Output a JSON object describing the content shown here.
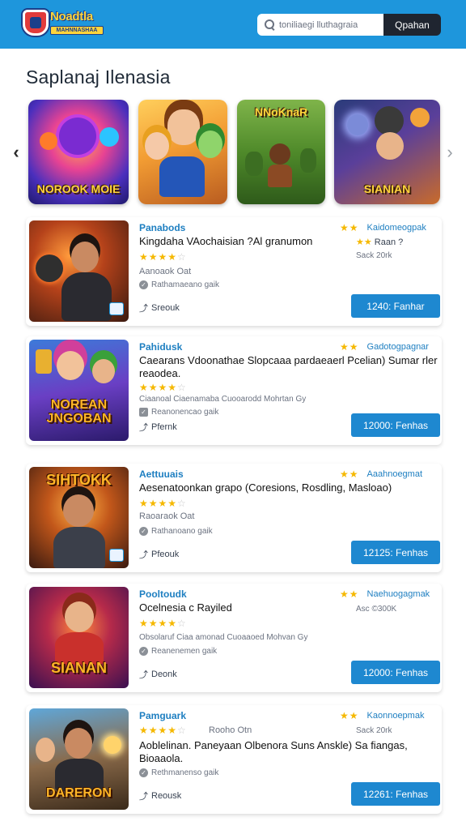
{
  "header": {
    "logo_word": "Noadtla",
    "logo_sub": "MAHNNASHAA",
    "search_placeholder": "toniliaegi lluthagraia",
    "search_button": "Qpahan"
  },
  "page_title": "Saplanaj Ilenasia",
  "carousel": {
    "tiles": [
      {
        "caption": "NOROOK MOIE"
      },
      {
        "caption": ""
      },
      {
        "caption": "NNoKnaR"
      },
      {
        "caption": "SIANIAN"
      }
    ]
  },
  "cards": [
    {
      "category": "Panabods",
      "title": "Kingdaha VAochaisian ?Al granumon",
      "rating_label": "Kaidomeogpak",
      "side_meta_1": "Raan ?",
      "side_meta_2": "Sack 20rk",
      "meta_1": "Aanoaok Oat",
      "check_text": "Rathamaeano gaik",
      "share_text": "Sreouk",
      "price": "1240: Fanhar",
      "thumb_caption": ""
    },
    {
      "category": "Pahidusk",
      "title": "Caearans Vdoonathae Slopcaaa pardaeaerl Pcelian) Sumar rler reaodea.",
      "rating_label": "Gadotogpagnar",
      "side_meta_1": "",
      "side_meta_2": "",
      "meta_1": "Ciaanoal Ciaenamaba Cuooarodd Mohrtan Gy",
      "check_text": "Reanonencao gaik",
      "share_text": "Pfernk",
      "price": "12000: Fenhas",
      "thumb_caption": "NOREAN JNGOBAN"
    },
    {
      "category": "Aettuuais",
      "title": "Aesenatoonkan grapo (Coresions, Rosdling, Masloao)",
      "rating_label": "Aaahnoegmat",
      "side_meta_1": "",
      "side_meta_2": "",
      "meta_1": "Raoaraok Oat",
      "check_text": "Rathanoano gaik",
      "share_text": "Pfeouk",
      "price": "12125: Fenhas",
      "thumb_caption": "SIHTOKK"
    },
    {
      "category": "Pooltoudk",
      "title": "Ocelnesia c Rayiled",
      "rating_label": "Naehuogagmak",
      "side_meta_1": "",
      "side_meta_2": "Asc ©300K",
      "meta_1": "Obsolaruf Ciaa amonad Cuoaaoed Mohvan Gy",
      "check_text": "Reanenemen gaik",
      "share_text": "Deonk",
      "price": "12000: Fenhas",
      "thumb_caption": "SIANAN"
    },
    {
      "category": "Pamguark",
      "title": "Aoblelinan. Paneyaan Olbenora Suns Anskle) Sa fiangas, Bioaaola.",
      "rating_label": "Kaonnoepmak",
      "side_meta_1": "",
      "side_meta_2": "Sack 20rk",
      "meta_1": "Rooho Otn",
      "check_text": "Rethmanenso gaik",
      "share_text": "Reousk",
      "price": "12261: Fenhas",
      "thumb_caption": "DARERON"
    }
  ]
}
